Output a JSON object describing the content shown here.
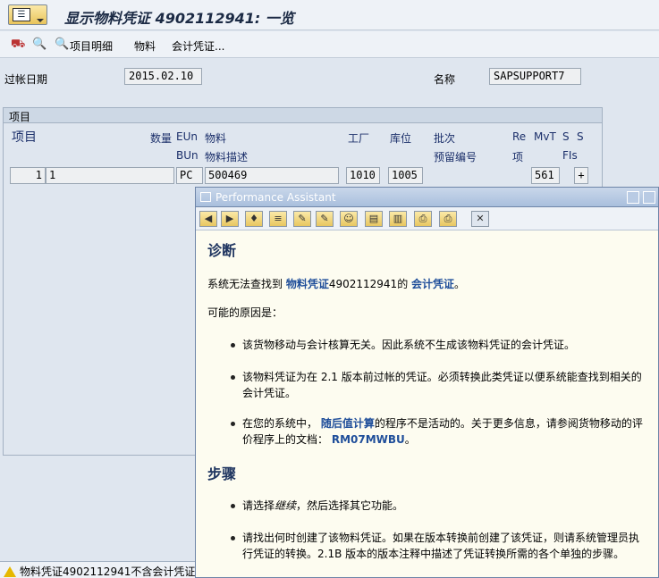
{
  "title": "显示物料凭证 4902112941: 一览",
  "toolbar": {
    "item_detail": "项目明细",
    "material": "物料",
    "accounting_doc": "会计凭证..."
  },
  "header": {
    "posting_date_label": "过帐日期",
    "posting_date_value": "2015.02.10",
    "name_label": "名称",
    "name_value": "SAPSUPPORT7"
  },
  "items": {
    "section_label": "项目",
    "col_item": "项目",
    "col_qty": "数量",
    "col_eun": "EUn",
    "col_bun": "BUn",
    "col_material": "物料",
    "col_material_desc": "物料描述",
    "col_plant": "工厂",
    "col_sloc": "库位",
    "col_batch": "批次",
    "col_reservation": "预留编号",
    "col_re": "Re",
    "col_re2": "项",
    "col_mvt": "MvT",
    "col_s1": "S",
    "col_s2": "S",
    "col_fis": "FIs",
    "row": {
      "item": "1",
      "qty": "1",
      "unit": "PC",
      "material": "500469",
      "plant": "1010",
      "sloc": "1005",
      "mvt": "561",
      "flag": "+"
    }
  },
  "status": {
    "text": "物料凭证4902112941不含会计凭证"
  },
  "assistant": {
    "window_title": "Performance Assistant",
    "diag_heading": "诊断",
    "diag_p_a": "系统无法查找到 ",
    "diag_link1": "物料凭证",
    "diag_p_b": "4902112941的 ",
    "diag_link2": "会计凭证",
    "diag_p_c": "。",
    "cause_intro": "可能的原因是：",
    "cause1": "该货物移动与会计核算无关。因此系统不生成该物料凭证的会计凭证。",
    "cause2": "该物料凭证为在 2.1 版本前过帐的凭证。必须转换此类凭证以便系统能查找到相关的会计凭证。",
    "cause3_a": "在您的系统中， ",
    "cause3_link": "随后值计算",
    "cause3_b": "的程序不是活动的。关于更多信息，请参阅货物移动的评价程序上的文档： ",
    "cause3_link2": "RM07MWBU",
    "cause3_c": "。",
    "steps_heading": "步骤",
    "step1_a": "请选择",
    "step1_it": "继续",
    "step1_b": "，然后选择其它功能。",
    "step2": "请找出何时创建了该物料凭证。如果在版本转换前创建了该凭证，则请系统管理员执行凭证的转换。2.1B 版本的版本注释中描述了凭证转换所需的各个单独的步骤。"
  }
}
